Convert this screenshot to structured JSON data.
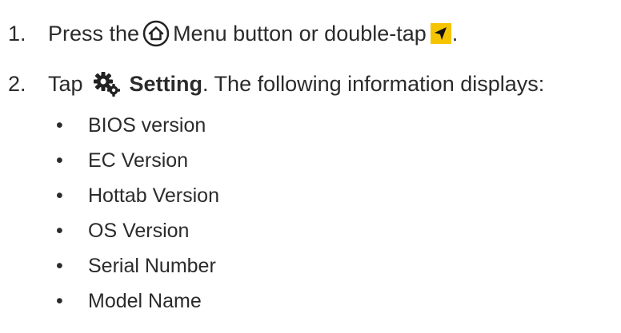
{
  "steps": [
    {
      "number": "1.",
      "text_before": "Press the",
      "text_after": "Menu button or double-tap",
      "end": "."
    },
    {
      "number": "2.",
      "text_before": "Tap",
      "bold_label": "Setting",
      "text_after": ". The following information displays:"
    }
  ],
  "bullet_items": [
    "BIOS version",
    "EC Version",
    "Hottab Version",
    "OS Version",
    "Serial Number",
    "Model Name"
  ],
  "bullet_symbol": "•",
  "icons": {
    "menu": "home-icon",
    "double_tap": "navigation-arrow-icon",
    "setting": "gear-icon"
  },
  "colors": {
    "text": "#2b2b2b",
    "arrow_background": "#f5c400"
  }
}
